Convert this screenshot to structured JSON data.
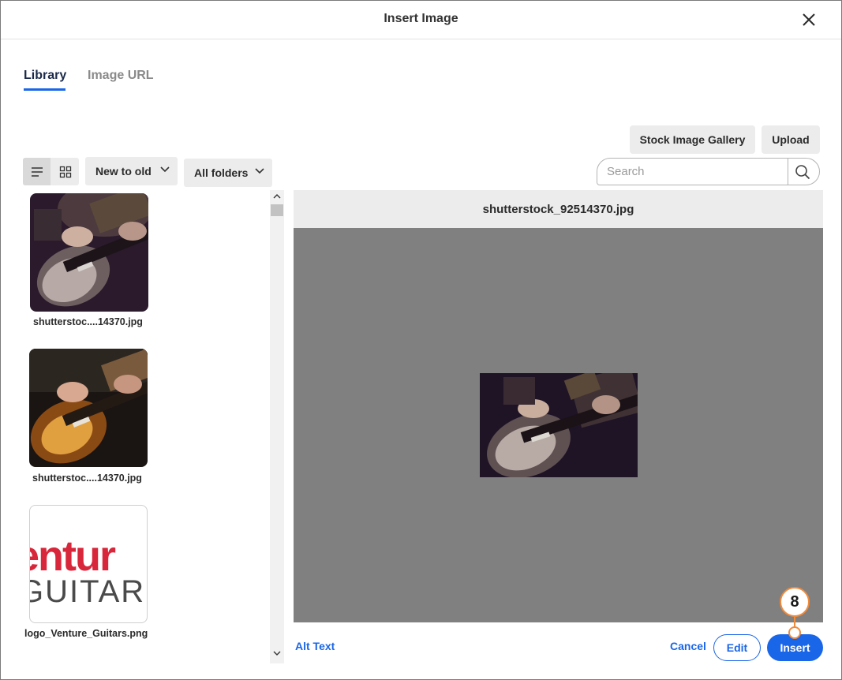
{
  "dialog": {
    "title": "Insert Image",
    "close_icon": "close-icon"
  },
  "tabs": [
    {
      "label": "Library",
      "active": true
    },
    {
      "label": "Image URL",
      "active": false
    }
  ],
  "actions": {
    "stock_gallery_label": "Stock Image Gallery",
    "upload_label": "Upload"
  },
  "toolbar": {
    "view_list_icon": "list-view-icon",
    "view_grid_icon": "grid-view-icon",
    "sort_selected": "New to old",
    "folder_selected": "All folders"
  },
  "search": {
    "placeholder": "Search",
    "value": ""
  },
  "files": [
    {
      "name": "shutterstoc....14370.jpg",
      "thumb": "guitar-dark-thumbnail"
    },
    {
      "name": "shutterstoc....14370.jpg",
      "thumb": "guitar-sunburst-thumbnail"
    },
    {
      "name": "logo_Venture_Guitars.png",
      "thumb": "venture-guitars-logo-thumbnail"
    }
  ],
  "logo_text": {
    "line1": "entur",
    "line2": "GUITAR"
  },
  "preview": {
    "filename": "shutterstock_92514370.jpg"
  },
  "footer": {
    "alt_text_label": "Alt Text",
    "cancel_label": "Cancel",
    "edit_label": "Edit",
    "insert_label": "Insert"
  },
  "callout": {
    "step_number": "8"
  },
  "colors": {
    "accent": "#1a66e8",
    "callout": "#f08b3c",
    "preview_bg": "#808080"
  }
}
